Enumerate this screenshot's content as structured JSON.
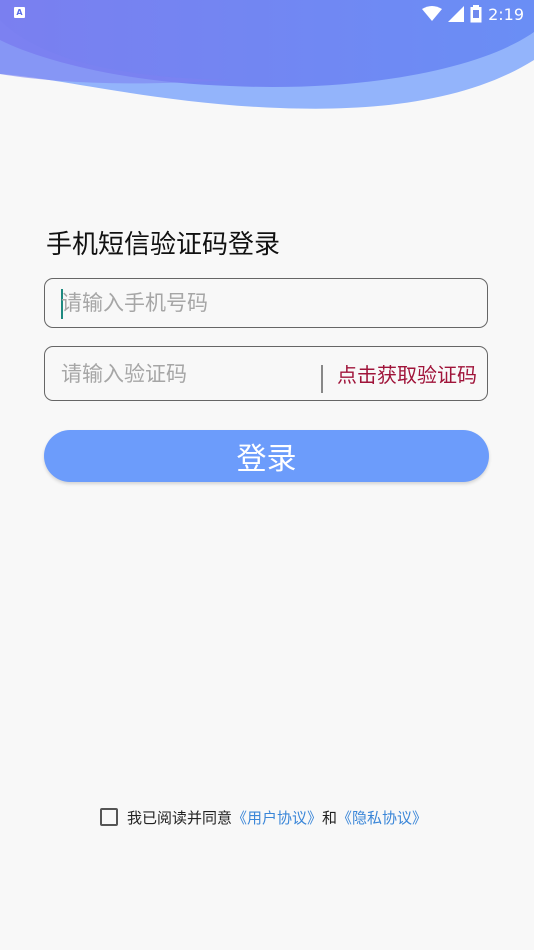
{
  "status_bar": {
    "time": "2:19",
    "left_badge": "A"
  },
  "page_title": "手机短信验证码登录",
  "phone_input": {
    "placeholder": "请输入手机号码",
    "value": ""
  },
  "code_input": {
    "placeholder": "请输入验证码",
    "value": ""
  },
  "get_code_label": "点击获取验证码",
  "login_label": "登录",
  "agreement": {
    "prefix": "我已阅读并同意",
    "user_agreement": "《用户协议》",
    "conjunction": "和",
    "privacy_policy": "《隐私协议》",
    "checked": false
  },
  "colors": {
    "wave_dark": "#5f79ea",
    "wave_light": "#93b4fb",
    "button": "#6c9cfb",
    "link": "#3a86d8",
    "get_code": "#a0143a"
  }
}
